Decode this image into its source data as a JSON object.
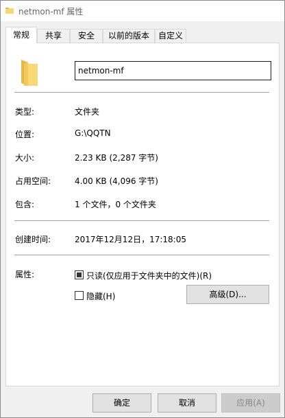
{
  "window": {
    "title": "netmon-mf 属性",
    "colors": {
      "folder": "#f8d775",
      "folder_dark": "#e8b84a",
      "border": "#adadad"
    }
  },
  "tabs": [
    {
      "label": "常规",
      "active": true
    },
    {
      "label": "共享",
      "active": false
    },
    {
      "label": "安全",
      "active": false
    },
    {
      "label": "以前的版本",
      "active": false
    },
    {
      "label": "自定义",
      "active": false
    }
  ],
  "general": {
    "name_value": "netmon-mf",
    "type_label": "类型:",
    "type_value": "文件夹",
    "location_label": "位置:",
    "location_value": "G:\\QQTN",
    "size_label": "大小:",
    "size_value": "2.23 KB (2,287 字节)",
    "disk_size_label": "占用空间:",
    "disk_size_value": "4.00 KB (4,096 字节)",
    "contains_label": "包含:",
    "contains_value": "1 个文件，0 个文件夹",
    "created_label": "创建时间:",
    "created_value": "2017年12月12日，17:18:05",
    "attributes_label": "属性:",
    "readonly_label": "只读(仅应用于文件夹中的文件)(R)",
    "readonly_checked": true,
    "hidden_label": "隐藏(H)",
    "hidden_checked": false,
    "advanced_button": "高级(D)..."
  },
  "footer": {
    "ok_label": "确定",
    "cancel_label": "取消",
    "apply_label": "应用(A)",
    "apply_disabled": true
  }
}
